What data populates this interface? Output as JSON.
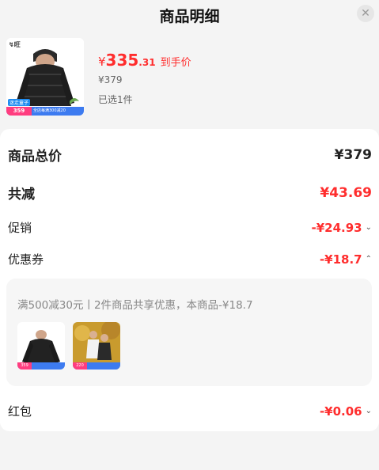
{
  "header": {
    "title": "商品明细"
  },
  "product": {
    "logo_text": "↯旺",
    "brand_tag": "迷走童子",
    "promo_price": "359",
    "promo_text": "全店每满300减20",
    "currency": "¥",
    "price_int": "335",
    "price_dec": ".31",
    "price_suffix": "到手价",
    "original_price": "¥379",
    "selected_text": "已选1件"
  },
  "breakdown": {
    "total_label": "商品总价",
    "total_value": "¥379",
    "discount_label": "共减",
    "discount_value": "¥43.69",
    "promo_label": "促销",
    "promo_value": "-¥24.93",
    "coupon_label": "优惠券",
    "coupon_value": "-¥18.7",
    "coupon_detail": "满500减30元丨2件商品共享优惠，本商品-¥18.7",
    "coupon_items": [
      {
        "price": "359"
      },
      {
        "price": "220"
      }
    ],
    "redpacket_label": "红包",
    "redpacket_value": "-¥0.06"
  },
  "colors": {
    "accent_red": "#ff2d2d",
    "promo_blue": "#3d7bf0",
    "promo_pink": "#ff3d7f"
  }
}
